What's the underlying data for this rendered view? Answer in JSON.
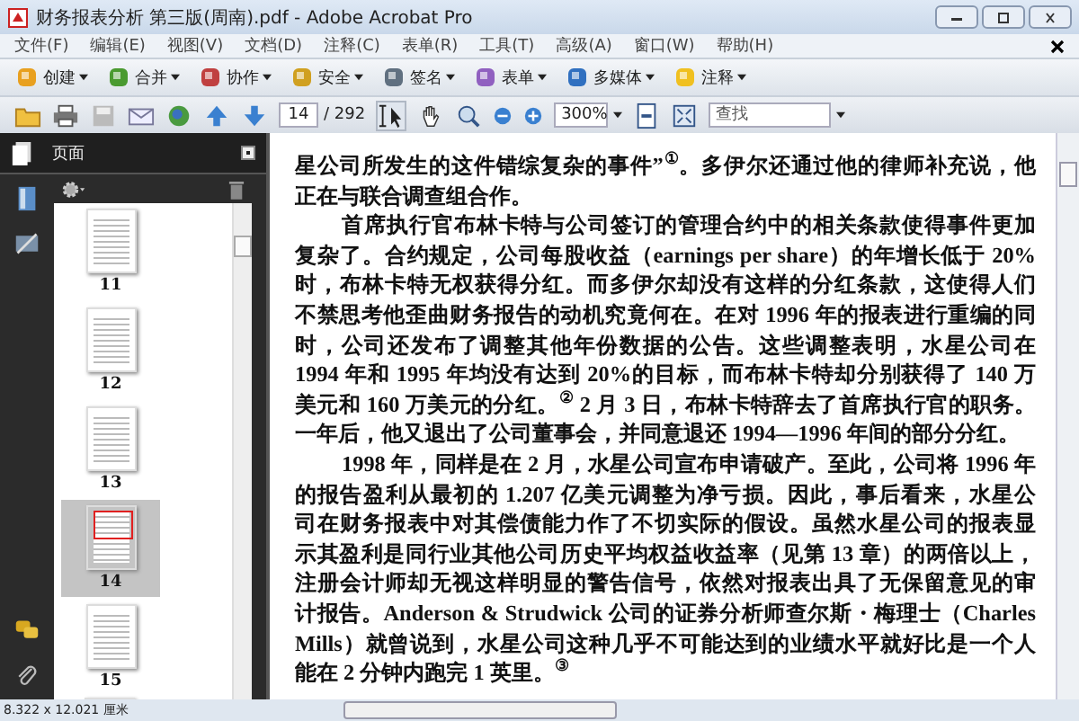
{
  "window": {
    "title": "财务报表分析 第三版(周南).pdf - Adobe Acrobat Pro"
  },
  "menu": [
    "文件(F)",
    "编辑(E)",
    "视图(V)",
    "文档(D)",
    "注释(C)",
    "表单(R)",
    "工具(T)",
    "高级(A)",
    "窗口(W)",
    "帮助(H)"
  ],
  "task_buttons": [
    {
      "label": "创建",
      "kind": "create"
    },
    {
      "label": "合并",
      "kind": "combine"
    },
    {
      "label": "协作",
      "kind": "collaborate"
    },
    {
      "label": "安全",
      "kind": "secure"
    },
    {
      "label": "签名",
      "kind": "sign"
    },
    {
      "label": "表单",
      "kind": "forms"
    },
    {
      "label": "多媒体",
      "kind": "multimedia"
    },
    {
      "label": "注释",
      "kind": "comment"
    }
  ],
  "nav": {
    "page": "14",
    "page_count": "/ 292",
    "zoom": "300%",
    "search": {
      "placeholder": "查找"
    }
  },
  "sidebar": {
    "panel_title": "页面",
    "thumbnails": [
      {
        "label": "11",
        "selected": false
      },
      {
        "label": "12",
        "selected": false
      },
      {
        "label": "13",
        "selected": false
      },
      {
        "label": "14",
        "selected": true
      },
      {
        "label": "15",
        "selected": false
      }
    ]
  },
  "document": {
    "paragraphs": [
      {
        "indent": false,
        "lines": [
          "星公司所发生的这件错综复杂的事件”$^{①}$。多伊尔还通过他的律师补充说，他",
          "正在与联合调查组合作。"
        ]
      },
      {
        "indent": true,
        "lines": [
          "首席执行官布林卡特与公司签订的管理合约中的相关条款使得事件更加",
          "复杂了。合约规定，公司每股收益（earnings per share）的年增长低于 20%",
          "时，布林卡特无权获得分红。而多伊尔却没有这样的分红条款，这使得人们",
          "不禁思考他歪曲财务报告的动机究竟何在。在对 1996 年的报表进行重编的同",
          "时，公司还发布了调整其他年份数据的公告。这些调整表明，水星公司在",
          "1994 年和 1995 年均没有达到 20%的目标，而布林卡特却分别获得了 140 万",
          "美元和 160 万美元的分红。$^{②}$ 2 月 3 日，布林卡特辞去了首席执行官的职务。",
          "一年后，他又退出了公司董事会，并同意退还 1994—1996 年间的部分分红。"
        ]
      },
      {
        "indent": true,
        "lines": [
          "1998 年，同样是在 2 月，水星公司宣布申请破产。至此，公司将 1996 年",
          "的报告盈利从最初的 1.207 亿美元调整为净亏损。因此，事后看来，水星公",
          "司在财务报表中对其偿债能力作了不切实际的假设。虽然水星公司的报表显",
          "示其盈利是同行业其他公司历史平均权益收益率（见第 13 章）的两倍以上，",
          "注册会计师却无视这样明显的警告信号，依然对报表出具了无保留意见的审",
          "计报告。Anderson & Strudwick 公司的证券分析师查尔斯・梅理士（Charles",
          "Mills）就曾说到，水星公司这种几乎不可能达到的业绩水平就好比是一个人",
          "能在 2 分钟内跑完 1 英里。$^{③}$"
        ]
      }
    ]
  },
  "status_bar": {
    "page_size": "8.322 x 12.021 厘米"
  }
}
